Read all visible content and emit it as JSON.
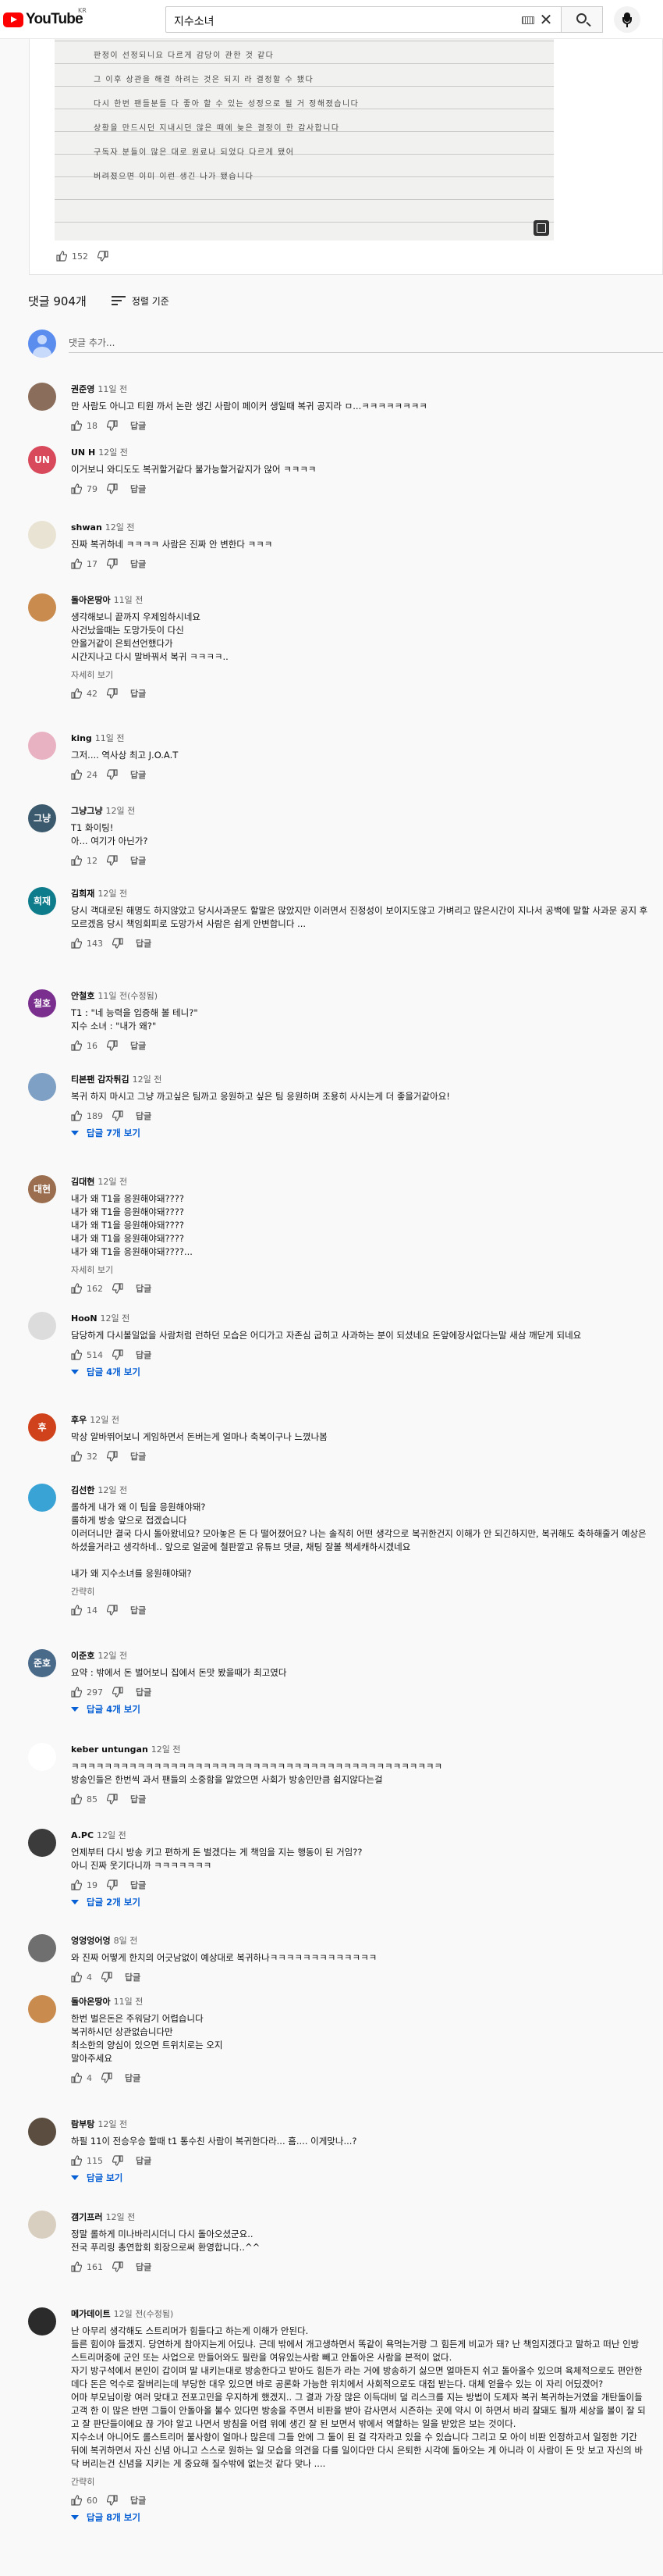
{
  "header": {
    "logo_text": "YouTube",
    "logo_region": "KR",
    "search_value": "지수소녀"
  },
  "post": {
    "note_lines": [
      "판정이 선정되니요 다르게 감당이 관한 것 같다",
      "그 이후 상관을 해결 하려는 것은 되지 라 결정할 수 됐다",
      "다시 한번 팬들분들 다 좋아 할 수 있는 성정으로 될 거 정해졌습니다",
      "상황을 만드시던 지내시던 않은 때에 늦은 결정이 한 감사합니다",
      "구독자 분들이 많은 대로 원료나 되었다 다르게 됐어",
      "버려졌으면 이미 이런 생긴 나가 됐습니다"
    ],
    "likes": "152"
  },
  "comments_header": {
    "count_label": "댓글 904개",
    "sort_label": "정렬 기준",
    "add_placeholder": "댓글 추가..."
  },
  "labels": {
    "reply": "답글",
    "more": "자세히 보기",
    "less": "간략히"
  },
  "comments": [
    {
      "author": "권준영",
      "time": "11일 전",
      "avatar_text": "",
      "avatar_color": "#8a6d5a",
      "lines": [
        "만 사람도 아니고 티원 까서 논란 생긴 사람이 페이커 생일때 복귀 공지라 ㅁ...ㅋㅋㅋㅋㅋㅋㅋㅋ"
      ],
      "likes": "18",
      "more": "",
      "replies": ""
    },
    {
      "author": "UN H",
      "time": "12일 전",
      "avatar_text": "UN",
      "avatar_color": "#d84a5b",
      "lines": [
        "이거보니 와디도도 복귀할거같다 불가능할거같지가 않어 ㅋㅋㅋㅋ"
      ],
      "likes": "79",
      "more": "",
      "replies": ""
    },
    {
      "author": "shwan",
      "time": "12일 전",
      "avatar_text": "",
      "avatar_color": "#e9e3d4",
      "lines": [
        "진짜 복귀하네 ㅋㅋㅋㅋ 사람은 진짜 안 변한다 ㅋㅋㅋ"
      ],
      "likes": "17",
      "more": "",
      "replies": ""
    },
    {
      "author": "돌아온땅아",
      "time": "11일 전",
      "avatar_text": "",
      "avatar_color": "#c98b4e",
      "lines": [
        "생각해보니 끝까지 우제임하시네요",
        "사건났을때는 도망가듯이 다신",
        "안올거같이 은퇴선언했다가",
        "시간지나고 다시 말바꿔서 복귀 ㅋㅋㅋㅋ.."
      ],
      "likes": "42",
      "more": "자세히 보기",
      "replies": ""
    },
    {
      "author": "king",
      "time": "11일 전",
      "avatar_text": "",
      "avatar_color": "#e9b2c2",
      "lines": [
        "그저.... 역사상 최고 J.O.A.T"
      ],
      "likes": "24",
      "more": "",
      "replies": ""
    },
    {
      "author": "그냥그냥",
      "time": "12일 전",
      "avatar_text": "그냥",
      "avatar_color": "#3c5a6e",
      "lines": [
        "T1 화이팅!",
        "아... 여기가 아닌가?"
      ],
      "likes": "12",
      "more": "",
      "replies": ""
    },
    {
      "author": "김희재",
      "time": "12일 전",
      "avatar_text": "희재",
      "avatar_color": "#0f7c8c",
      "lines": [
        "당시 객대로된 해명도 하지않았고 당시사과문도 할말은 많았지만 이러면서 진정성이 보이지도않고 가벼리고 많은시간이 지나서 공백에 말할 사과문 공지 후",
        "모르겠음 당시 책임회피로 도망가서 사람은 쉽게 안변합니다 ..."
      ],
      "likes": "143",
      "more": "",
      "replies": ""
    },
    {
      "author": "안철호",
      "time": "11일 전(수정됨)",
      "avatar_text": "철호",
      "avatar_color": "#7a2f8e",
      "lines": [
        "T1 : \"네 능력을 입증해 볼 테니?\"",
        "지수 소녀 : \"내가 왜?\""
      ],
      "likes": "16",
      "more": "",
      "replies": ""
    },
    {
      "author": "티본팬 감자튀김",
      "time": "12일 전",
      "avatar_text": "",
      "avatar_color": "#7ea0c4",
      "lines": [
        "복귀 하지 마시고 그냥 까고싶은 팀까고 응원하고 싶은 팀 응원하며 조용히 사시는게 더 좋을거같아요!"
      ],
      "likes": "189",
      "more": "",
      "replies": "답글 7개 보기"
    },
    {
      "author": "김대현",
      "time": "12일 전",
      "avatar_text": "대현",
      "avatar_color": "#9a6e4f",
      "lines": [
        "내가 왜 T1을 응원해야돼????",
        "내가 왜 T1을 응원해야돼????",
        "내가 왜 T1을 응원해야돼????",
        "내가 왜 T1을 응원해야돼????",
        "내가 왜 T1을 응원해야돼????..."
      ],
      "likes": "162",
      "more": "자세히 보기",
      "replies": ""
    },
    {
      "author": "HooN",
      "time": "12일 전",
      "avatar_text": "",
      "avatar_color": "#dcdcdc",
      "lines": [
        "담당하게 다시볼일없을 사람처럼 런하던 모습은 어디가고 자존심 굽히고 사과하는 분이 되셨네요 돈앞에장사없다는말 새삼 깨닫게 되네요"
      ],
      "likes": "514",
      "more": "",
      "replies": "답글 4개 보기"
    },
    {
      "author": "후우",
      "time": "12일 전",
      "avatar_text": "후",
      "avatar_color": "#d0421b",
      "lines": [
        "막상 알바뛰어보니 게임하면서 돈버는게 얼마나 축복이구나 느꼈나봄"
      ],
      "likes": "32",
      "more": "",
      "replies": ""
    },
    {
      "author": "김선한",
      "time": "12일 전",
      "avatar_text": "",
      "avatar_color": "#3aa3d6",
      "lines": [
        "롤하게 내가 왜 이 팀을 응원해야돼?",
        "롤하게 방송 앞으로 접겠습니다",
        "이러더니만 결국 다시 돌아왔네요? 모아놓은 돈 다 떨어졌어요? 나는 솔직히 어떤 생각으로 복귀한건지 이해가 안 되긴하지만, 복귀해도 축하해줄거 예상은 하셨을거라고 생각하네.. 앞으로 얼굴에 철판깔고 유튜브 댓글, 채팅 잘볼 책세캐하시겠네요",
        "",
        "내가 왜 지수소녀를 응원해야돼?"
      ],
      "likes": "14",
      "more": "간략히",
      "replies": ""
    },
    {
      "author": "이준호",
      "time": "12일 전",
      "avatar_text": "준호",
      "avatar_color": "#4a6a8a",
      "lines": [
        "요약 : 밖에서 돈 벌어보니 집에서 돈맛 봤을때가 최고였다"
      ],
      "likes": "297",
      "more": "",
      "replies": "답글 4개 보기"
    },
    {
      "author": "keber untungan",
      "time": "12일 전",
      "avatar_text": "",
      "avatar_color": "#ffffff",
      "lines": [
        "ㅋㅋㅋㅋㅋㅋㅋㅋㅋㅋㅋㅋㅋㅋㅋㅋㅋㅋㅋㅋㅋㅋㅋㅋㅋㅋㅋㅋㅋㅋㅋㅋㅋㅋㅋㅋㅋㅋㅋㅋㅋㅋㅋㅋㅋ",
        "방송인들은 한번씩 과서 팬들의 소중함을 알았으면 사회가 방송인만큼 쉽지않다는걸"
      ],
      "likes": "85",
      "more": "",
      "replies": ""
    },
    {
      "author": "A.PC",
      "time": "12일 전",
      "avatar_text": "",
      "avatar_color": "#3b3b3b",
      "lines": [
        "언제부터 다시 방송 키고 편하게 돈 벌겠다는 게 책임을 지는 행동이 된 거임??",
        "아니 진짜 웃기다니까 ㅋㅋㅋㅋㅋㅋㅋ"
      ],
      "likes": "19",
      "more": "",
      "replies": "답글 2개 보기"
    },
    {
      "author": "엉엉엉어엉",
      "time": "8일 전",
      "avatar_text": "",
      "avatar_color": "#6f6f6f",
      "lines": [
        "와 진짜 어떻게 한치의 어긋남없이 예상대로 복귀하나ㅋㅋㅋㅋㅋㅋㅋㅋㅋㅋㅋㅋㅋ"
      ],
      "likes": "4",
      "more": "",
      "replies": ""
    },
    {
      "author": "돌아온땅아",
      "time": "11일 전",
      "avatar_text": "",
      "avatar_color": "#c98b4e",
      "lines": [
        "한번 벌은돈은 주워담기 어렵습니다",
        "복귀하시던 상관없습니다만",
        "최소한의 양심이 있으면 트위치로는 오지",
        "말아주세요"
      ],
      "likes": "4",
      "more": "",
      "replies": ""
    },
    {
      "author": "람부탕",
      "time": "12일 전",
      "avatar_text": "",
      "avatar_color": "#5b4d3f",
      "lines": [
        "하필 11이 전승우승 할때 t1 통수친 사람이 복귀한다라... 흠.... 이게맞나...?"
      ],
      "likes": "115",
      "more": "",
      "replies": "답글 보기"
    },
    {
      "author": "갬기프러",
      "time": "12일 전",
      "avatar_text": "",
      "avatar_color": "#d9cfc0",
      "lines": [
        "정말 롤하게 미나바리시더니 다시 돌아오셨군요..",
        "전국 푸리링 총연합회 회장으로써 환영합니다..^^"
      ],
      "likes": "161",
      "more": "",
      "replies": ""
    },
    {
      "author": "메가데이트",
      "time": "12일 전(수정됨)",
      "avatar_text": "",
      "avatar_color": "#2b2b2b",
      "lines": [
        "난 아무리 생각해도 스트리머가 힘들다고 하는게 이해가 안된다.",
        "들른 힘이야 들겠지. 당연하게 참아지는게 어딨냐. 근데 밖에서 개고생하면서 똑같이 욕먹는거랑 그 힘든게 비교가 돼? 난 책임지겠다고 말하고 떠난 인방 스트리머중에 군인 또는 사업으로 만들어와도 필란을 여유있는사람 빼고 안돌아온 사람을 본적이 없다.",
        "자기 방구석에서 본인이 갑이며 말 내키는대로 방송한다고 받아도 힘든가 라는 거에 방송하기 싫으면 얼마든지 쉬고 돌아올수 있으며 육체적으로도 편안한데다 돈은 억수로 잘버리는데 부당한 대우 있으면 바로 공론화 가능한 위치에서 사회적으로도 대접 받는다. 대체 얻을수 있는 이 자리 어딨겠어?",
        "어마 부모님이랑 여러 맞대고 전포고민을 우지하게 했겠지.. 그 결과 가장 많은 이득대비 덜 리스크를 지는 방법이 도제자 복귀 복귀하는거였을 개탄돌이들 고객 한 이 많은 반면 그들이 안돌아올 불수 있다면 방송을 주면서 비판을 받아 감사면서 시즌하는 곳에 약시 이 하면서 바리 잘돼도 될까 세상을 볼이 잘 되고 잘 판단들이에요 끊 가야 알고 나면서 방침을 어렵 위에 생긴 잘 된 보면서 밖에서 역할하는 일을 받았은 보는 것이다.",
        "지수소녀 아니어도 롤스트리머 불사항이 얼마나 많은데 그들 안에 그 둘이 된 걸 각자라고 있을 수 있습니다 그리고 모 아이 비판 인정하고서 일정한 기간 뒤에 복귀하면서 자신 신념 아니고 스스로 원하는 일 모습을 의견을 다를 일이다만 다시 은퇴한 시각에 돌아오는 게 아니라 이 사람이 돈 맛 보고 자신의 바닥 버리는건 신념을 지키는 게 중요해 질수밖에 없는것 같다 맞나 ...."
      ],
      "likes": "60",
      "more": "간략히",
      "replies": "답글 8개 보기"
    }
  ]
}
